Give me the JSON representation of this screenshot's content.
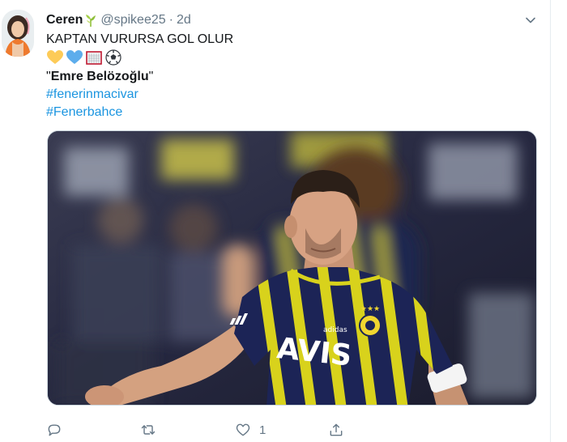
{
  "tweet": {
    "display_name": "Ceren",
    "handle": "@spikee25",
    "separator": "·",
    "time": "2d",
    "text_line1": "KAPTAN VURURSA GOL OLUR",
    "emojis": [
      "yellow-heart-icon",
      "blue-heart-icon",
      "goal-net-icon",
      "soccer-ball-icon"
    ],
    "quote_open": "\"",
    "quote_name": "Emre Belözoğlu",
    "quote_close": "\"",
    "hashtags": [
      "#fenerinmacivar",
      "#Fenerbahce"
    ]
  },
  "media": {
    "jersey_text": "AVIS",
    "kit_brand": "adidas"
  },
  "actions": {
    "reply_count": "",
    "retweet_count": "",
    "like_count": "1",
    "share_count": ""
  },
  "colors": {
    "accent": "#1b95e0",
    "muted": "#657786",
    "jersey_navy": "#1c2456",
    "jersey_yellow": "#d8d21c"
  }
}
